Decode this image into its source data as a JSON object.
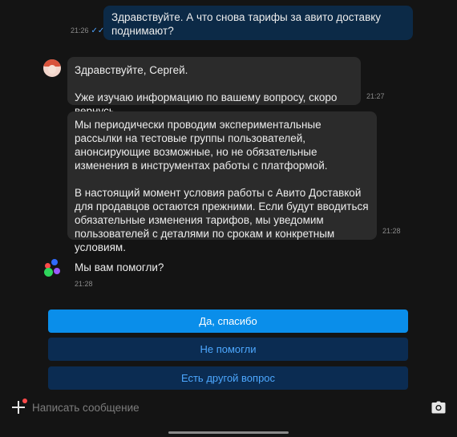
{
  "messages": {
    "outgoing": {
      "text": "Здравствуйте. А что снова тарифы за авито доставку поднимают?",
      "time": "21:26",
      "status_icon": "double-check-icon"
    },
    "incoming_1": {
      "greeting": "Здравствуйте, Сергей.",
      "body": "Уже изучаю информацию по вашему вопросу, скоро вернусь.",
      "time": "21:27"
    },
    "incoming_2": {
      "para1": "Мы периодически проводим экспериментальные рассылки на тестовые группы пользователей, анонсирующие возможные, но не обязательные изменения в инструментах работы с платформой.",
      "para2": "В настоящий момент условия работы с Авито Доставкой для продавцов остаются прежними. Если будут вводиться обязательные изменения тарифов, мы уведомим пользователей с деталями по срокам и конкретным условиям.",
      "time": "21:28"
    },
    "bot": {
      "text": "Мы вам помогли?",
      "time": "21:28"
    }
  },
  "quick_replies": {
    "yes": "Да, спасибо",
    "no": "Не помогли",
    "other": "Есть другой вопрос"
  },
  "composer": {
    "placeholder": "Написать сообщение"
  },
  "colors": {
    "background": "#141414",
    "outgoing_bubble": "#0c2a47",
    "incoming_bubble": "#2b2b2b",
    "primary_button": "#0a8eea",
    "secondary_button": "#0b2c52",
    "link_blue": "#4da8ff"
  }
}
